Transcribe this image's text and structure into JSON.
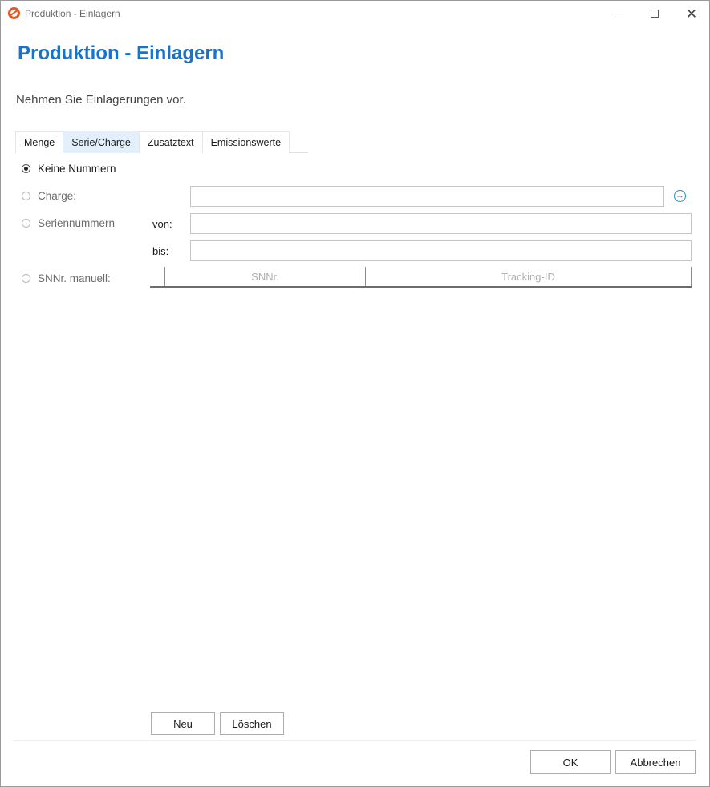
{
  "window": {
    "title": "Produktion - Einlagern",
    "minimize_label": "",
    "close_label": "✕"
  },
  "header": {
    "heading": "Produktion - Einlagern",
    "subtitle": "Nehmen Sie Einlagerungen vor."
  },
  "tabs": [
    {
      "label": "Menge",
      "active": false
    },
    {
      "label": "Serie/Charge",
      "active": true
    },
    {
      "label": "Zusatztext",
      "active": false
    },
    {
      "label": "Emissionswerte",
      "active": false
    }
  ],
  "options": {
    "keine_nummern": {
      "label": "Keine Nummern",
      "selected": true
    },
    "charge": {
      "label": "Charge:",
      "selected": false,
      "value": ""
    },
    "seriennummern": {
      "label": "Seriennummern",
      "selected": false,
      "von_label": "von:",
      "bis_label": "bis:",
      "von_value": "",
      "bis_value": ""
    },
    "snnr_manuell": {
      "label": "SNNr. manuell:",
      "selected": false
    }
  },
  "grid": {
    "columns": [
      "SNNr.",
      "Tracking-ID"
    ],
    "rows": []
  },
  "grid_buttons": {
    "new_label": "Neu",
    "delete_label": "Löschen"
  },
  "footer": {
    "ok_label": "OK",
    "cancel_label": "Abbrechen"
  },
  "colors": {
    "accent": "#1a73c8",
    "active_tab": "#e3f0fb",
    "app_icon": "#e2592a"
  },
  "icons": {
    "app": "app-logo-icon",
    "charge_go": "arrow-right-circle-icon"
  }
}
